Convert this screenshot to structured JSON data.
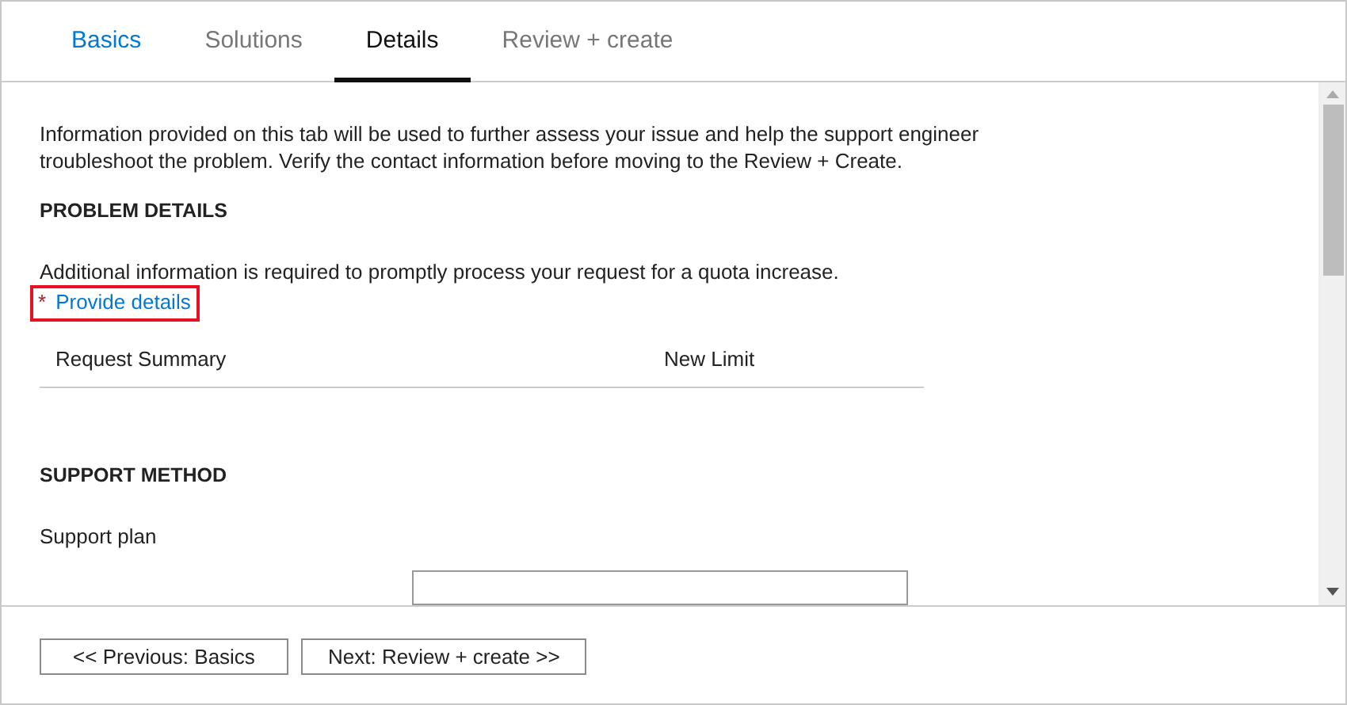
{
  "tabs": [
    {
      "label": "Basics",
      "selected": false,
      "visited": true
    },
    {
      "label": "Solutions",
      "selected": false,
      "visited": false
    },
    {
      "label": "Details",
      "selected": true,
      "visited": false
    },
    {
      "label": "Review + create",
      "selected": false,
      "visited": false
    }
  ],
  "intro": "Information provided on this tab will be used to further assess your issue and help the support engineer troubleshoot the problem. Verify the contact information before moving to the Review + Create.",
  "problem_details": {
    "heading": "PROBLEM DETAILS",
    "text": "Additional information is required to promptly process your request for a quota increase.",
    "required_mark": "*",
    "link": "Provide details",
    "highlighted": true,
    "table": {
      "columns": [
        "Request Summary",
        "New Limit"
      ]
    }
  },
  "support_method": {
    "heading": "SUPPORT METHOD",
    "label": "Support plan"
  },
  "buttons": [
    "<< Previous: Basics",
    "Next: Review + create >>"
  ]
}
